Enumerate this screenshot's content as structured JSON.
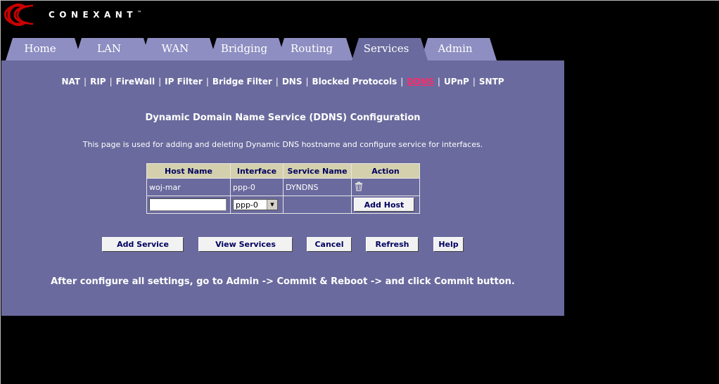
{
  "brand": {
    "name": "CONEXANT",
    "tm": "™",
    "color": "#cc0000"
  },
  "tabs": [
    {
      "label": "Home"
    },
    {
      "label": "LAN"
    },
    {
      "label": "WAN"
    },
    {
      "label": "Bridging"
    },
    {
      "label": "Routing"
    },
    {
      "label": "Services",
      "active": true
    },
    {
      "label": "Admin"
    }
  ],
  "subnav": {
    "items": [
      "NAT",
      "RIP",
      "FireWall",
      "IP Filter",
      "Bridge Filter",
      "DNS",
      "Blocked Protocols",
      "DDNS",
      "UPnP",
      "SNTP"
    ],
    "active": "DDNS",
    "separator": "|"
  },
  "page": {
    "title": "Dynamic Domain Name Service (DDNS) Configuration",
    "description": "This page is used for adding and deleting Dynamic DNS hostname and configure service for interfaces."
  },
  "table": {
    "headers": [
      "Host Name",
      "Interface",
      "Service Name",
      "Action"
    ],
    "rows": [
      {
        "host": "woj-mar",
        "interface": "ppp-0",
        "service": "DYNDNS",
        "action_icon": "trash-icon"
      }
    ],
    "new_row": {
      "host_value": "",
      "interface_selected": "ppp-0",
      "add_label": "Add Host"
    }
  },
  "buttons": {
    "add_service": "Add Service",
    "view_services": "View Services",
    "cancel": "Cancel",
    "refresh": "Refresh",
    "help": "Help"
  },
  "footnote": "After configure all settings, go to Admin -> Commit & Reboot -> and click Commit button.",
  "colors": {
    "panel": "#6a6a9e",
    "tab_inactive": "#8e8ec2",
    "tab_active": "#6a6a9e",
    "header_bg": "#d4d0ad",
    "active_link": "#ff2a6a"
  }
}
